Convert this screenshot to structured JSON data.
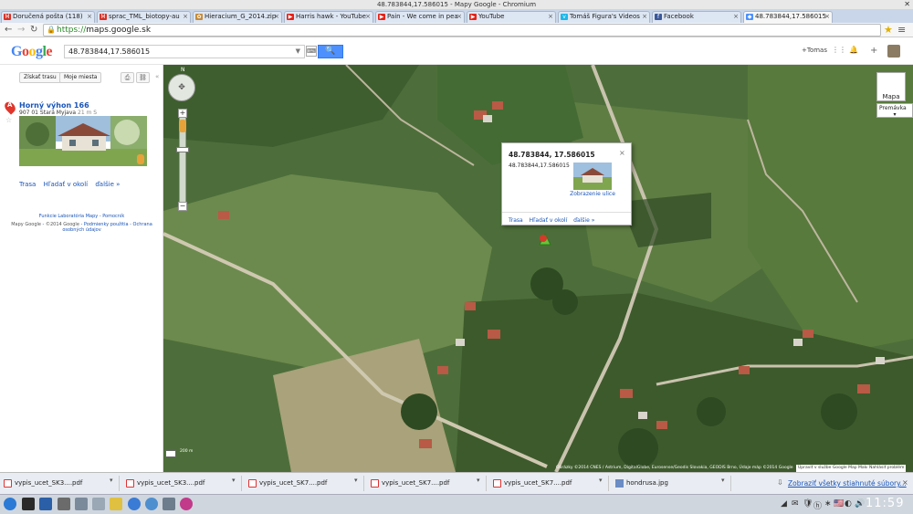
{
  "window": {
    "title": "48.783844,17.586015 - Mapy Google - Chromium",
    "close_glyph": "✕"
  },
  "tabs": [
    {
      "label": "Doručená pošta (118)",
      "fav": "M",
      "fav_color": "#d93025",
      "close": "×"
    },
    {
      "label": "sprac_TML_biotopy-au",
      "fav": "M",
      "fav_color": "#d93025",
      "close": "×"
    },
    {
      "label": "Hieracium_G_2014.zip",
      "fav": "✿",
      "fav_color": "#c58a3a",
      "close": "×"
    },
    {
      "label": "Harris hawk - YouTube",
      "fav": "▶",
      "fav_color": "#e62117",
      "close": "×"
    },
    {
      "label": "Pain - We come in pea",
      "fav": "▶",
      "fav_color": "#e62117",
      "close": "×"
    },
    {
      "label": "YouTube",
      "fav": "▶",
      "fav_color": "#e62117",
      "close": "×"
    },
    {
      "label": "Tomáš Figura's Videos",
      "fav": "v",
      "fav_color": "#1ab7ea",
      "close": "×"
    },
    {
      "label": "Facebook",
      "fav": "f",
      "fav_color": "#3b5998",
      "close": "×"
    },
    {
      "label": "48.783844,17.586015",
      "fav": "◆",
      "fav_color": "#4d90fe",
      "close": "×",
      "active": true
    }
  ],
  "toolbar": {
    "back": "←",
    "forward": "→",
    "reload": "↻",
    "url_scheme": "https://",
    "url_host": "maps.google.sk",
    "star": "★",
    "menu": "≡"
  },
  "header": {
    "logo": {
      "letters": [
        "G",
        "o",
        "o",
        "g",
        "l",
        "e"
      ],
      "colors": [
        "#4285f4",
        "#ea4335",
        "#fbbc05",
        "#4285f4",
        "#34a853",
        "#ea4335"
      ]
    },
    "search_value": "48.783844,17.586015",
    "search_dd": "▼",
    "kbd_icon": "⌨",
    "search_icon": "🔍",
    "user": "+Tomas",
    "apps_icon": "⋮⋮",
    "bell_icon": "🔔",
    "share_icon": "+"
  },
  "left": {
    "route_btn": "Získať trasu",
    "my_places_btn": "Moje miesta",
    "print_icon": "⎙",
    "link_icon": "⛓",
    "collapse": "«",
    "marker_letter": "A",
    "star": "☆",
    "place_name": "Horný výhon 166",
    "place_addr": "907 01 Stará Myjava",
    "place_dist": "21 m S",
    "actions": [
      "Trasa",
      "Hľadať v okolí",
      "ďalšie »"
    ],
    "footer1": "Funkcie Laboratória Mapy",
    "footer1b": "Pomocník",
    "footer2_g": "Mapy Google",
    "footer2_c": "©2014 Google",
    "footer2_a": "Podmienky použitia",
    "footer2_b": "Ochrana osobných údajov"
  },
  "map": {
    "north": "N",
    "pan_glyph": "✥",
    "zoom_in": "+",
    "zoom_out": "−",
    "maptype_label": "Mapa",
    "maptype2_label": "Premávka",
    "maptype2_caret": "▾",
    "bubble": {
      "title": "48.783844, 17.586015",
      "star": "☆",
      "close": "×",
      "coord": "48.783844,17.586015",
      "streetview": "Zobrazenie ulice",
      "links": [
        "Trasa",
        "Hľadať v okolí",
        "ďalšie »"
      ]
    },
    "scale": "200 m",
    "attribution": "Obrázky ©2014 CNES / Astrium, DigitalGlobe, Eurosense/Geodis Slovakia, GEODIS Brno, Údaje máp ©2014 Google",
    "edit_btn": "Upraviť v službe Google Map Maker",
    "report_btn": "Nahlásiť problém"
  },
  "downloads": {
    "items": [
      {
        "label": "vypis_ucet_SK3....pdf",
        "type": "pdf"
      },
      {
        "label": "vypis_ucet_SK3....pdf",
        "type": "pdf"
      },
      {
        "label": "vypis_ucet_SK7....pdf",
        "type": "pdf"
      },
      {
        "label": "vypis_ucet_SK7....pdf",
        "type": "pdf"
      },
      {
        "label": "vypis_ucet_SK7....pdf",
        "type": "pdf"
      },
      {
        "label": "hondrusa.jpg",
        "type": "img"
      }
    ],
    "caret": "▾",
    "show_all": "Zobraziť všetky stiahnuté súbory...",
    "show_all_icon": "⇩",
    "close": "×"
  },
  "taskbar": {
    "clock": "11:59",
    "launchers": [
      {
        "name": "launcher-terminal",
        "color": "#2a2a2a"
      },
      {
        "name": "launcher-screen",
        "color": "#2b5fa8"
      },
      {
        "name": "launcher-files",
        "color": "#6b6b6b"
      },
      {
        "name": "launcher-display",
        "color": "#7b8a9b"
      },
      {
        "name": "launcher-tools",
        "color": "#9aa7b5"
      },
      {
        "name": "launcher-pencil",
        "color": "#e0c040"
      },
      {
        "name": "launcher-chromium",
        "color": "#3a7bd5"
      },
      {
        "name": "launcher-globe",
        "color": "#4e8fd0"
      },
      {
        "name": "launcher-settings",
        "color": "#6d7d8d"
      },
      {
        "name": "launcher-eye",
        "color": "#c23a8a"
      }
    ],
    "tray_icons": [
      "◢",
      "✉",
      "🛡",
      "ⓗ",
      "∗",
      "🇺🇸",
      "◐",
      "🔊"
    ]
  }
}
